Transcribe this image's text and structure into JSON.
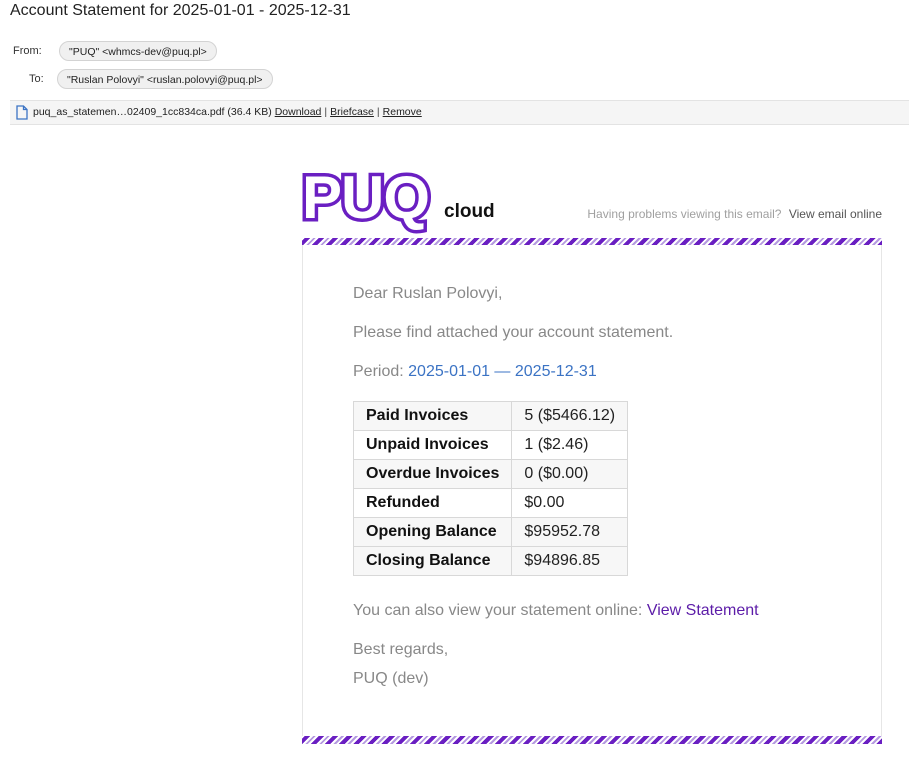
{
  "email": {
    "subject": "Account Statement for 2025-01-01 - 2025-12-31",
    "from_label": "From:",
    "from": "\"PUQ\" <whmcs-dev@puq.pl>",
    "to_label": "To:",
    "to": "\"Ruslan Polovyi\" <ruslan.polovyi@puq.pl>"
  },
  "attachment": {
    "icon": "file-icon",
    "name": "puq_as_statemen…02409_1cc834ca.pdf",
    "size": "(36.4 KB)",
    "download": "Download",
    "briefcase": "Briefcase",
    "remove": "Remove",
    "separator": "|"
  },
  "body": {
    "logo_main": "PUQ",
    "logo_sub": "cloud",
    "problem_text": "Having problems viewing this email?",
    "view_online": "View email online",
    "greeting": "Dear Ruslan Polovyi,",
    "intro": "Please find attached your account statement.",
    "period_label": "Period: ",
    "period_start": "2025-01-01",
    "period_dash": " — ",
    "period_end": "2025-12-31",
    "rows": [
      {
        "label": "Paid Invoices",
        "value": "5 ($5466.12)"
      },
      {
        "label": "Unpaid Invoices",
        "value": "1 ($2.46)"
      },
      {
        "label": "Overdue Invoices",
        "value": "0 ($0.00)"
      },
      {
        "label": "Refunded",
        "value": "$0.00"
      },
      {
        "label": "Opening Balance",
        "value": "$95952.78"
      },
      {
        "label": "Closing Balance",
        "value": "$94896.85"
      }
    ],
    "online_text": "You can also view your statement online: ",
    "view_statement": "View Statement",
    "regards": "Best regards,",
    "signature": "PUQ (dev)"
  },
  "colors": {
    "brand": "#6a1fc2",
    "link": "#3b73c4",
    "muted_text": "#888888"
  }
}
